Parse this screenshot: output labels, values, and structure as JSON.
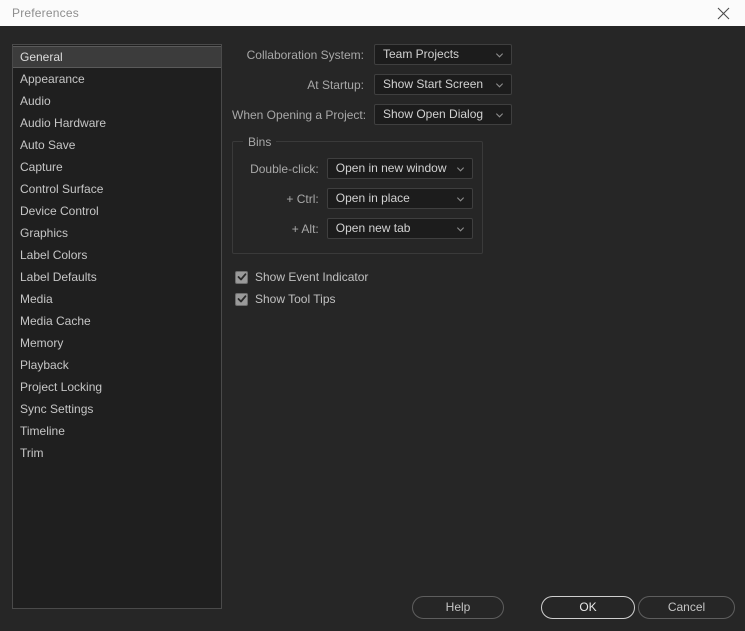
{
  "window": {
    "title": "Preferences",
    "close_icon": "close-icon"
  },
  "sidebar": {
    "selected": "General",
    "items": [
      {
        "label": "General"
      },
      {
        "label": "Appearance"
      },
      {
        "label": "Audio"
      },
      {
        "label": "Audio Hardware"
      },
      {
        "label": "Auto Save"
      },
      {
        "label": "Capture"
      },
      {
        "label": "Control Surface"
      },
      {
        "label": "Device Control"
      },
      {
        "label": "Graphics"
      },
      {
        "label": "Label Colors"
      },
      {
        "label": "Label Defaults"
      },
      {
        "label": "Media"
      },
      {
        "label": "Media Cache"
      },
      {
        "label": "Memory"
      },
      {
        "label": "Playback"
      },
      {
        "label": "Project Locking"
      },
      {
        "label": "Sync Settings"
      },
      {
        "label": "Timeline"
      },
      {
        "label": "Trim"
      }
    ]
  },
  "general": {
    "fields": [
      {
        "label": "Collaboration System:",
        "value": "Team Projects"
      },
      {
        "label": "At Startup:",
        "value": "Show Start Screen"
      },
      {
        "label": "When Opening a Project:",
        "value": "Show Open Dialog"
      }
    ],
    "bins": {
      "legend": "Bins",
      "fields": [
        {
          "label": "Double-click:",
          "value": "Open in new window"
        },
        {
          "label": "+ Ctrl:",
          "value": "Open in place"
        },
        {
          "label": "+ Alt:",
          "value": "Open new tab"
        }
      ]
    },
    "checkboxes": [
      {
        "label": "Show Event Indicator",
        "checked": true
      },
      {
        "label": "Show Tool Tips",
        "checked": true
      }
    ]
  },
  "footer": {
    "help_label": "Help",
    "ok_label": "OK",
    "cancel_label": "Cancel"
  },
  "colors": {
    "window_background": "#262626",
    "titlebar_background": "#fbfbfb",
    "list_background": "#1f1f1f",
    "selection_background": "#3c3c3c",
    "control_background": "#1c1c1c",
    "text_primary": "#c8c8c8",
    "text_label": "#a8a8a8",
    "border": "#3f3f3f",
    "focus_border": "#cfcfcf"
  }
}
